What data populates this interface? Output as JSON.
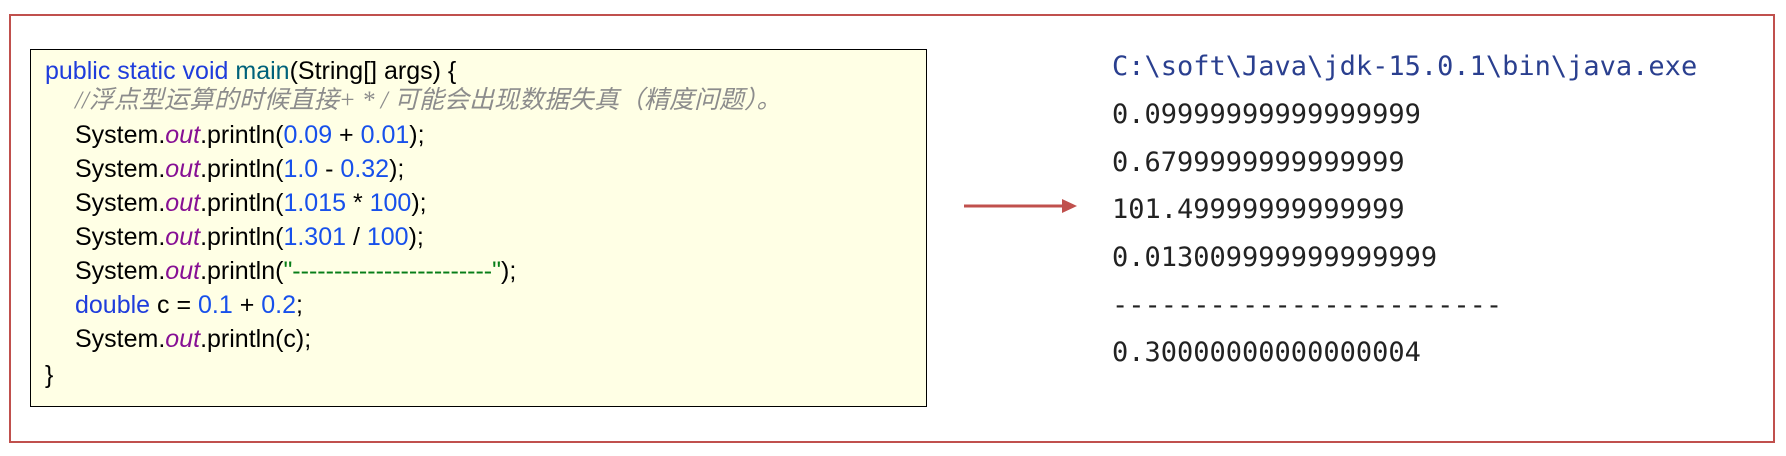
{
  "code": {
    "l1": {
      "kw": "public static void ",
      "fn": "main",
      "rest": "(String[] args) {"
    },
    "comment": "//浮点型运算的时候直接+ * / 可能会出现数据失真（精度问题）。",
    "sys": "System.",
    "out": "out",
    "println_open": ".println(",
    "close": ");",
    "l3": {
      "a": "0.09",
      "op": " + ",
      "b": "0.01"
    },
    "l4": {
      "a": "1.0",
      "op": " - ",
      "b": "0.32"
    },
    "l5": {
      "a": "1.015",
      "op": " * ",
      "b": "100"
    },
    "l6": {
      "a": "1.301",
      "op": " / ",
      "b": "100"
    },
    "l7": {
      "str": "\"------------------------\""
    },
    "l8": {
      "kw": "double",
      "mid": " c = ",
      "a": "0.1",
      "op": " + ",
      "b": "0.2",
      "end": ";"
    },
    "l9": {
      "arg": ".println(c);"
    },
    "l10": "}"
  },
  "console": {
    "path": "C:\\soft\\Java\\jdk-15.0.1\\bin\\java.exe",
    "lines": [
      "0.09999999999999999",
      "0.6799999999999999",
      "101.49999999999999",
      "0.013009999999999999",
      "------------------------",
      "0.30000000000000004"
    ]
  },
  "colors": {
    "frame": "#c0504d",
    "code_bg": "#ffffe5",
    "keyword": "#1f3ddc",
    "number": "#1750eb",
    "string": "#067d17",
    "field": "#871094",
    "comment": "#8c8c8c",
    "arrow": "#c0504d"
  }
}
